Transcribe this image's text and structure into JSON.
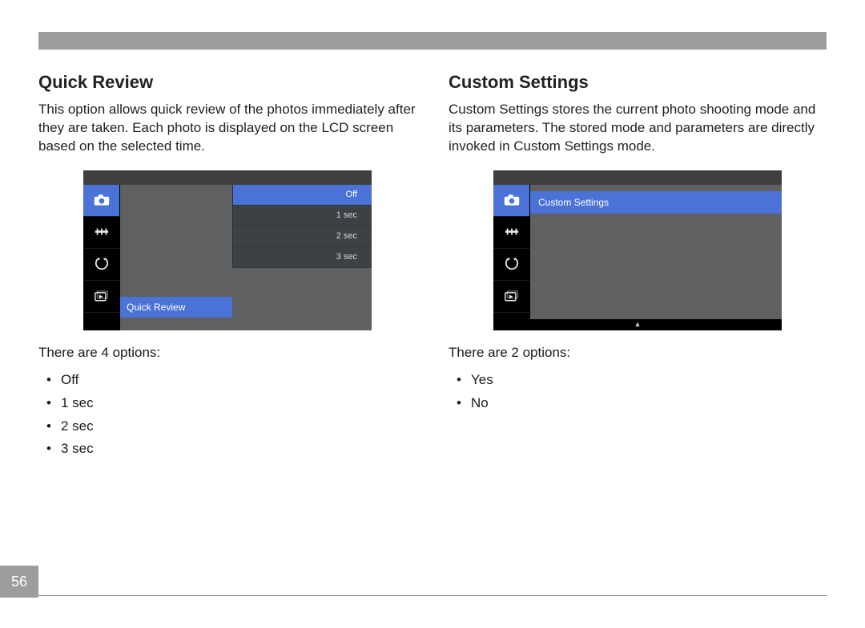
{
  "page_number": "56",
  "left": {
    "heading": "Quick Review",
    "body": "This option allows quick review of the photos immediately after they are taken. Each photo is displayed on the LCD screen based on the selected time.",
    "menu": {
      "selected_label": "Quick Review",
      "options": [
        "Off",
        "1 sec",
        "2 sec",
        "3 sec"
      ],
      "selected_option_index": 0
    },
    "options_intro": "There are 4 options:",
    "options_list": [
      "Off",
      "1 sec",
      "2 sec",
      "3 sec"
    ]
  },
  "right": {
    "heading": "Custom Settings",
    "body": "Custom Settings stores the current photo shooting mode and its parameters. The stored mode and parameters are directly invoked in Custom Settings mode.",
    "menu": {
      "selected_label": "Custom Settings"
    },
    "options_intro": "There are 2 options:",
    "options_list": [
      "Yes",
      "No"
    ]
  },
  "tabs": [
    "camera",
    "settings",
    "flash",
    "playback"
  ]
}
